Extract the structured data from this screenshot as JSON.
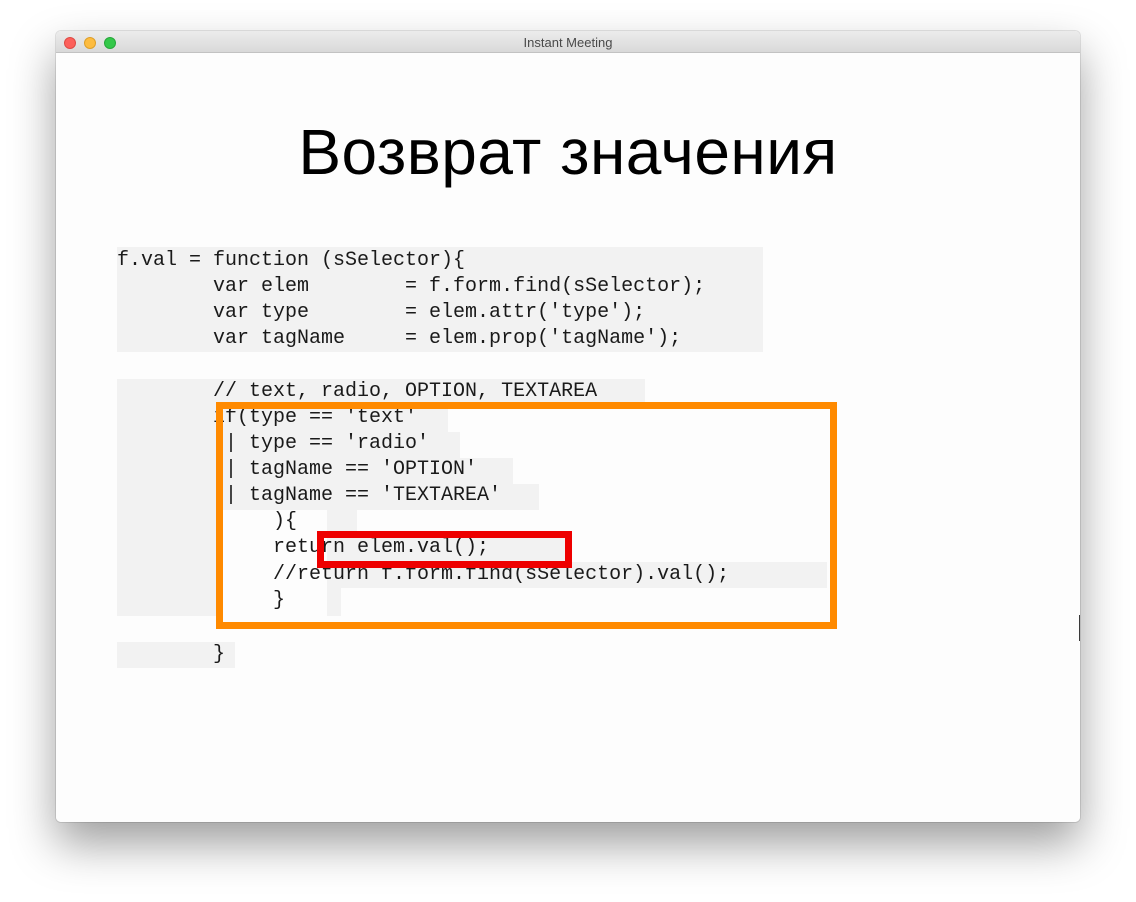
{
  "window": {
    "title": "Instant Meeting"
  },
  "slide": {
    "title": "Возврат значения",
    "code": {
      "lines": [
        "f.val = function (sSelector){",
        "        var elem        = f.form.find(sSelector);",
        "        var type        = elem.attr('type');",
        "        var tagName     = elem.prop('tagName');",
        "        // text, radio, OPTION, TEXTAREA",
        "        if(type == 'text'",
        "        || type == 'radio'",
        "        || tagName == 'OPTION'",
        "        || tagName == 'TEXTAREA'",
        "             ){",
        "             return elem.val();",
        "             //return f.form.find(sSelector).val();",
        "             }",
        "        }"
      ]
    },
    "highlights": {
      "outer_color": "#ff8a00",
      "inner_color": "#ee0000"
    }
  }
}
